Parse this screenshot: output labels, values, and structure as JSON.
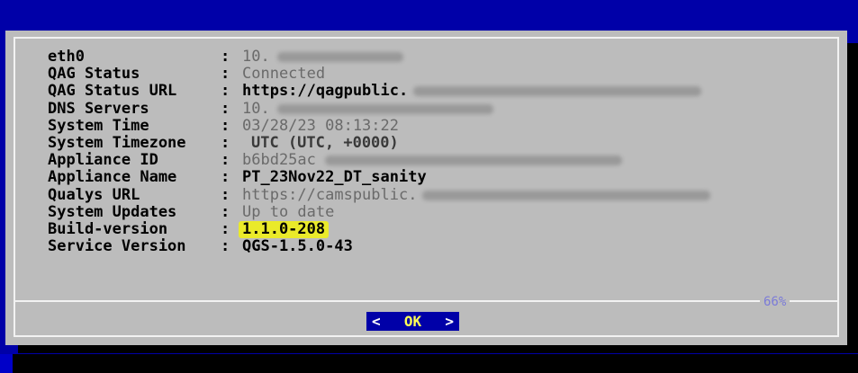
{
  "info_rows": [
    {
      "label": "eth0",
      "value": "10.",
      "value_style": "dim",
      "redacted": true
    },
    {
      "label": "QAG Status",
      "value": "Connected",
      "value_style": "dim",
      "redacted": false
    },
    {
      "label": "QAG Status URL",
      "value": "https://qagpublic.",
      "value_style": "bold",
      "redacted": true
    },
    {
      "label": "DNS Servers",
      "value": "10.",
      "value_style": "dim",
      "redacted": true
    },
    {
      "label": "System Time",
      "value": "03/28/23 08:13:22",
      "value_style": "dim",
      "redacted": false
    },
    {
      "label": "System Timezone",
      "value": "UTC (UTC, +0000)",
      "value_style": "dim-bold",
      "redacted": false
    },
    {
      "label": "Appliance ID",
      "value": "b6bd25ac",
      "value_style": "dim",
      "redacted": true
    },
    {
      "label": "Appliance Name",
      "value": "PT_23Nov22_DT_sanity",
      "value_style": "bold",
      "redacted": false
    },
    {
      "label": "Qualys URL",
      "value": "https://camspublic.",
      "value_style": "dim",
      "redacted": true
    },
    {
      "label": "System Updates",
      "value": "Up to date",
      "value_style": "dim",
      "redacted": false
    },
    {
      "label": "Build-version",
      "value": "1.1.0-208",
      "value_style": "bold",
      "redacted": false,
      "highlight": true
    },
    {
      "label": "Service Version",
      "value": "QGS-1.5.0-43",
      "value_style": "bold",
      "redacted": false
    }
  ],
  "separator": ":",
  "progress_text": "66%",
  "button": {
    "left_arrow": "<",
    "label": "OK",
    "right_arrow": ">"
  },
  "colors": {
    "screen_bg": "#0000a8",
    "dialog_bg": "#bcbcbc",
    "border": "#f2f2f2",
    "highlight": "#eaea2a",
    "button_bg": "#0000a8",
    "button_label": "#ffff55"
  }
}
